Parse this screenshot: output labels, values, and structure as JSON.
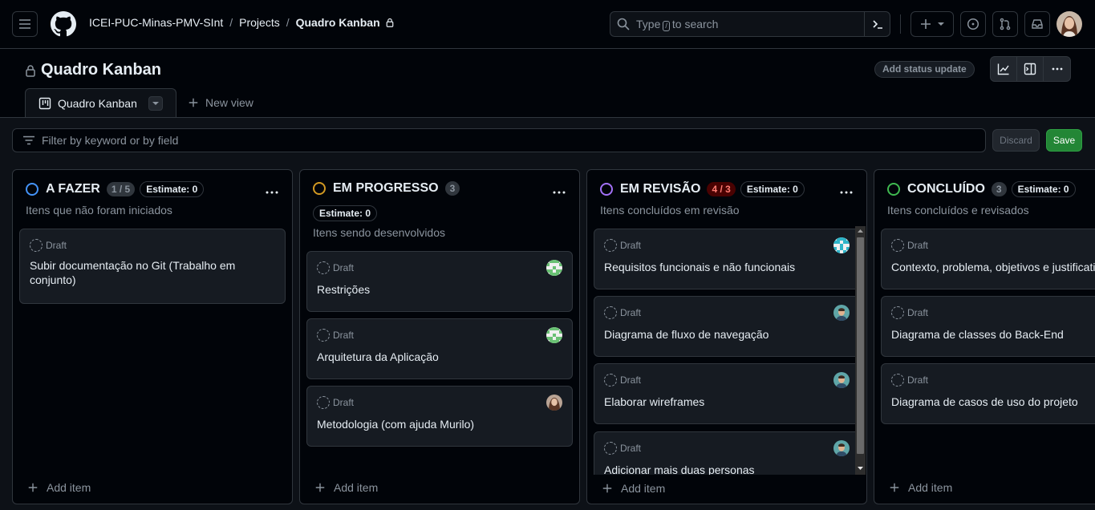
{
  "header": {
    "breadcrumbs": [
      "ICEI-PUC-Minas-PMV-SInt",
      "Projects",
      "Quadro Kanban"
    ],
    "separator": "/",
    "search": {
      "placeholder_before": "Type",
      "kbd": "/",
      "placeholder_after": "to search"
    }
  },
  "project": {
    "title": "Quadro Kanban",
    "status_update_label": "Add status update",
    "tabs": [
      {
        "label": "Quadro Kanban",
        "icon": "board-icon"
      }
    ],
    "new_view_label": "New view"
  },
  "filter": {
    "placeholder": "Filter by keyword or by field",
    "discard_label": "Discard",
    "save_label": "Save"
  },
  "columns": [
    {
      "title": "A FAZER",
      "count": "1 / 5",
      "estimate": "Estimate: 0",
      "description": "Itens que não foram iniciados",
      "color": "#4493f8",
      "cards": [
        {
          "status": "Draft",
          "title": "Subir documentação no Git (Trabalho em conjunto)",
          "avatar": ""
        }
      ],
      "add_item": "Add item"
    },
    {
      "title": "EM PROGRESSO",
      "count": "3",
      "estimate": "Estimate: 0",
      "description": "Itens sendo desenvolvidos",
      "color": "#d29922",
      "cards": [
        {
          "status": "Draft",
          "title": "Restrições",
          "avatar": "green-identicon"
        },
        {
          "status": "Draft",
          "title": "Arquitetura da Aplicação",
          "avatar": "green-identicon"
        },
        {
          "status": "Draft",
          "title": "Metodologia (com ajuda Murilo)",
          "avatar": "photo-woman"
        }
      ],
      "add_item": "Add item"
    },
    {
      "title": "EM REVISÃO",
      "count": "4 / 3",
      "estimate": "Estimate: 0",
      "description": "Itens concluídos em revisão",
      "color": "#a371f7",
      "cards": [
        {
          "status": "Draft",
          "title": "Requisitos funcionais e não funcionais",
          "avatar": "teal-identicon"
        },
        {
          "status": "Draft",
          "title": "Diagrama de fluxo de navegação",
          "avatar": "photo-man"
        },
        {
          "status": "Draft",
          "title": "Elaborar wireframes",
          "avatar": "photo-man"
        },
        {
          "status": "Draft",
          "title": "Adicionar mais duas personas",
          "avatar": "photo-man"
        }
      ],
      "add_item": "Add item"
    },
    {
      "title": "CONCLUÍDO",
      "count": "3",
      "estimate": "Estimate: 0",
      "description": "Itens concluídos e revisados",
      "color": "#3fb950",
      "cards": [
        {
          "status": "Draft",
          "title": "Contexto, problema, objetivos e justificativa",
          "avatar": ""
        },
        {
          "status": "Draft",
          "title": "Diagrama de classes do Back-End",
          "avatar": ""
        },
        {
          "status": "Draft",
          "title": "Diagrama de casos de uso do projeto",
          "avatar": ""
        }
      ],
      "add_item": "Add item"
    }
  ]
}
